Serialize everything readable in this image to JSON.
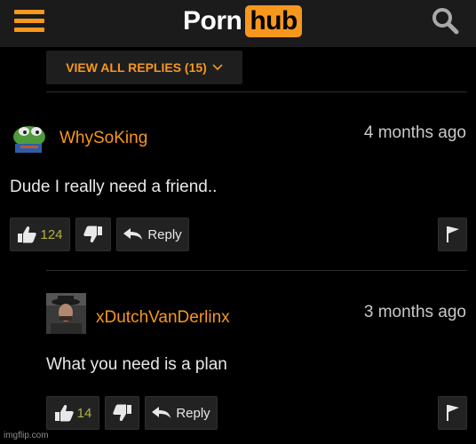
{
  "header": {
    "logo_left": "Porn",
    "logo_right": "hub"
  },
  "view_replies": "VIEW ALL REPLIES (15)",
  "comments": [
    {
      "username": "WhySoKing",
      "time": "4 months ago",
      "text": "Dude I really need a friend..",
      "likes": "124",
      "reply_label": "Reply"
    },
    {
      "username": "xDutchVanDerlinx",
      "time": "3 months ago",
      "text": "What you need is a plan",
      "likes": "14",
      "reply_label": "Reply"
    }
  ],
  "watermark": "imgflip.com",
  "colors": {
    "accent": "#f7971d",
    "header_bg": "#1b1b1b",
    "background": "#000000",
    "button_bg": "#222222",
    "likes_count": "#b2b246"
  },
  "icons": [
    "hamburger-menu-icon",
    "search-icon",
    "chevron-down-icon",
    "thumbs-up-icon",
    "thumbs-down-icon",
    "reply-arrow-icon",
    "flag-icon"
  ]
}
